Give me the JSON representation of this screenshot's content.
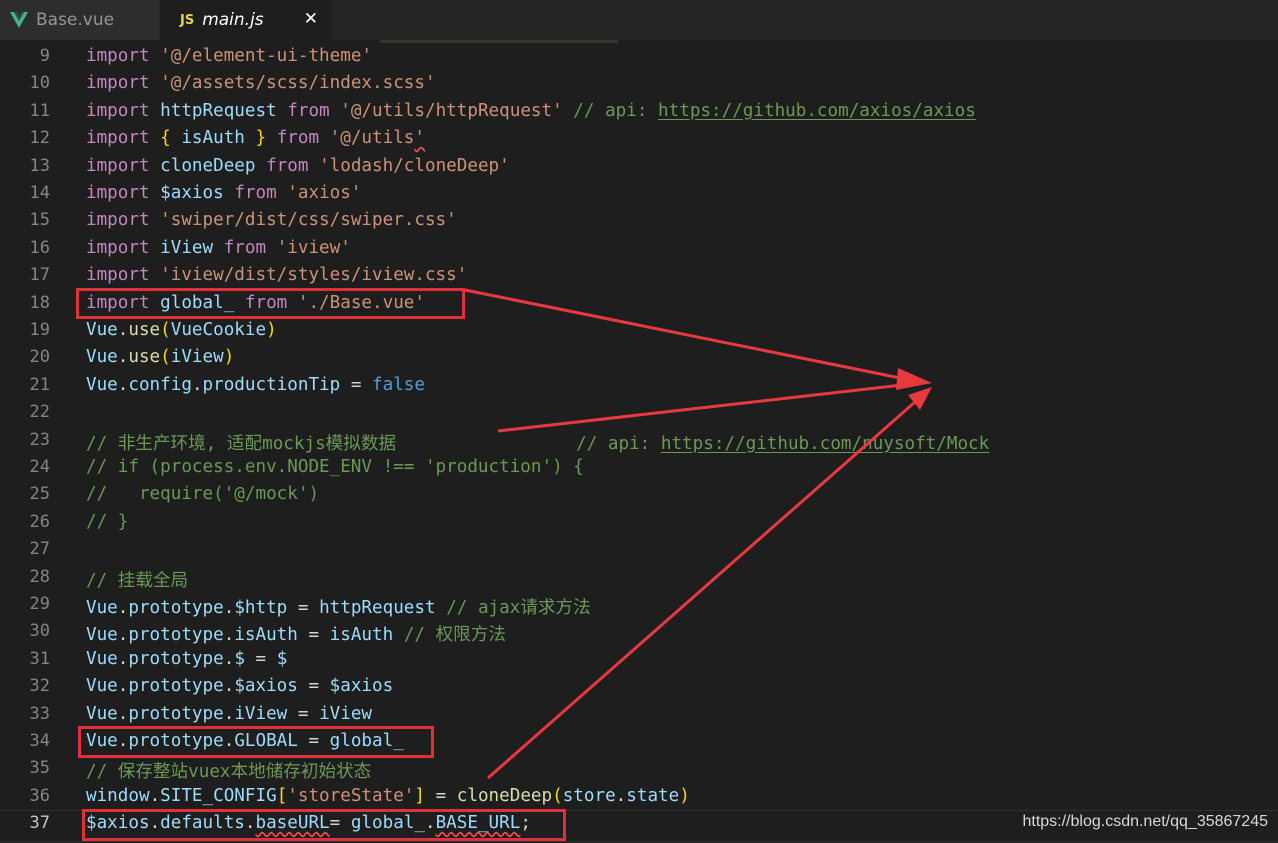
{
  "tabs": [
    {
      "label": "Base.vue",
      "icon": "vue-icon"
    },
    {
      "label": "main.js",
      "icon_label": "JS",
      "icon": "js-icon",
      "close": "✕"
    }
  ],
  "lines": [
    {
      "n": "9",
      "tokens": [
        [
          "k",
          "import"
        ],
        [
          "o",
          " "
        ],
        [
          "s",
          "'@/element-ui-theme'"
        ]
      ]
    },
    {
      "n": "10",
      "tokens": [
        [
          "k",
          "import"
        ],
        [
          "o",
          " "
        ],
        [
          "s",
          "'@/assets/scss/index.scss'"
        ]
      ]
    },
    {
      "n": "11",
      "tokens": [
        [
          "k",
          "import"
        ],
        [
          "o",
          " "
        ],
        [
          "i",
          "httpRequest"
        ],
        [
          "o",
          " "
        ],
        [
          "k",
          "from"
        ],
        [
          "o",
          " "
        ],
        [
          "s",
          "'@/utils/httpRequest'"
        ],
        [
          "o",
          " "
        ],
        [
          "c",
          "// api: "
        ],
        [
          "c u",
          "https://github.com/axios/axios"
        ]
      ]
    },
    {
      "n": "12",
      "tokens": [
        [
          "k",
          "import"
        ],
        [
          "o",
          " "
        ],
        [
          "p",
          "{"
        ],
        [
          "o",
          " "
        ],
        [
          "i",
          "isAuth"
        ],
        [
          "o",
          " "
        ],
        [
          "p",
          "}"
        ],
        [
          "o",
          " "
        ],
        [
          "k",
          "from"
        ],
        [
          "o",
          " "
        ],
        [
          "s",
          "'@/utils"
        ],
        [
          "s sq",
          "'"
        ]
      ]
    },
    {
      "n": "13",
      "tokens": [
        [
          "k",
          "import"
        ],
        [
          "o",
          " "
        ],
        [
          "i",
          "cloneDeep"
        ],
        [
          "o",
          " "
        ],
        [
          "k",
          "from"
        ],
        [
          "o",
          " "
        ],
        [
          "s",
          "'lodash/cloneDeep'"
        ]
      ]
    },
    {
      "n": "14",
      "tokens": [
        [
          "k",
          "import"
        ],
        [
          "o",
          " "
        ],
        [
          "i",
          "$axios"
        ],
        [
          "o",
          " "
        ],
        [
          "k",
          "from"
        ],
        [
          "o",
          " "
        ],
        [
          "s",
          "'axios'"
        ]
      ]
    },
    {
      "n": "15",
      "tokens": [
        [
          "k",
          "import"
        ],
        [
          "o",
          " "
        ],
        [
          "s",
          "'swiper/dist/css/swiper.css'"
        ]
      ]
    },
    {
      "n": "16",
      "tokens": [
        [
          "k",
          "import"
        ],
        [
          "o",
          " "
        ],
        [
          "i",
          "iView"
        ],
        [
          "o",
          " "
        ],
        [
          "k",
          "from"
        ],
        [
          "o",
          " "
        ],
        [
          "s",
          "'iview'"
        ]
      ]
    },
    {
      "n": "17",
      "tokens": [
        [
          "k",
          "import"
        ],
        [
          "o",
          " "
        ],
        [
          "s",
          "'iview/dist/styles/iview.css'"
        ]
      ]
    },
    {
      "n": "18",
      "tokens": [
        [
          "k",
          "import"
        ],
        [
          "o",
          " "
        ],
        [
          "i",
          "global_"
        ],
        [
          "o",
          " "
        ],
        [
          "k",
          "from"
        ],
        [
          "o",
          " "
        ],
        [
          "s",
          "'./Base.vue'"
        ]
      ]
    },
    {
      "n": "19",
      "tokens": [
        [
          "i",
          "Vue"
        ],
        [
          "o",
          "."
        ],
        [
          "f",
          "use"
        ],
        [
          "p",
          "("
        ],
        [
          "i",
          "VueCookie"
        ],
        [
          "p",
          ")"
        ]
      ]
    },
    {
      "n": "20",
      "tokens": [
        [
          "i",
          "Vue"
        ],
        [
          "o",
          "."
        ],
        [
          "f",
          "use"
        ],
        [
          "p",
          "("
        ],
        [
          "i",
          "iView"
        ],
        [
          "p",
          ")"
        ]
      ]
    },
    {
      "n": "21",
      "tokens": [
        [
          "i",
          "Vue"
        ],
        [
          "o",
          "."
        ],
        [
          "i",
          "config"
        ],
        [
          "o",
          "."
        ],
        [
          "i",
          "productionTip"
        ],
        [
          "o",
          " = "
        ],
        [
          "b",
          "false"
        ]
      ]
    },
    {
      "n": "22",
      "tokens": []
    },
    {
      "n": "23",
      "tokens": [
        [
          "c",
          "// 非生产环境, 适配mockjs模拟数据                 // api: "
        ],
        [
          "c u",
          "https://github.com/nuysoft/Mock"
        ]
      ]
    },
    {
      "n": "24",
      "tokens": [
        [
          "c",
          "// if (process.env.NODE_ENV !== 'production') {"
        ]
      ]
    },
    {
      "n": "25",
      "tokens": [
        [
          "c",
          "//   require('@/mock')"
        ]
      ]
    },
    {
      "n": "26",
      "tokens": [
        [
          "c",
          "// }"
        ]
      ]
    },
    {
      "n": "27",
      "tokens": []
    },
    {
      "n": "28",
      "tokens": [
        [
          "c",
          "// 挂载全局"
        ]
      ]
    },
    {
      "n": "29",
      "tokens": [
        [
          "i",
          "Vue"
        ],
        [
          "o",
          "."
        ],
        [
          "i",
          "prototype"
        ],
        [
          "o",
          "."
        ],
        [
          "i",
          "$http"
        ],
        [
          "o",
          " = "
        ],
        [
          "i",
          "httpRequest"
        ],
        [
          "o",
          " "
        ],
        [
          "c",
          "// ajax请求方法"
        ]
      ]
    },
    {
      "n": "30",
      "tokens": [
        [
          "i",
          "Vue"
        ],
        [
          "o",
          "."
        ],
        [
          "i",
          "prototype"
        ],
        [
          "o",
          "."
        ],
        [
          "i",
          "isAuth"
        ],
        [
          "o",
          " = "
        ],
        [
          "i",
          "isAuth"
        ],
        [
          "o",
          " "
        ],
        [
          "c",
          "// 权限方法"
        ]
      ]
    },
    {
      "n": "31",
      "tokens": [
        [
          "i",
          "Vue"
        ],
        [
          "o",
          "."
        ],
        [
          "i",
          "prototype"
        ],
        [
          "o",
          "."
        ],
        [
          "i",
          "$"
        ],
        [
          "o",
          " = "
        ],
        [
          "i",
          "$"
        ]
      ]
    },
    {
      "n": "32",
      "tokens": [
        [
          "i",
          "Vue"
        ],
        [
          "o",
          "."
        ],
        [
          "i",
          "prototype"
        ],
        [
          "o",
          "."
        ],
        [
          "i",
          "$axios"
        ],
        [
          "o",
          " = "
        ],
        [
          "i",
          "$axios"
        ]
      ]
    },
    {
      "n": "33",
      "tokens": [
        [
          "i",
          "Vue"
        ],
        [
          "o",
          "."
        ],
        [
          "i",
          "prototype"
        ],
        [
          "o",
          "."
        ],
        [
          "i",
          "iView"
        ],
        [
          "o",
          " = "
        ],
        [
          "i",
          "iView"
        ]
      ]
    },
    {
      "n": "34",
      "tokens": [
        [
          "i",
          "Vue"
        ],
        [
          "o",
          "."
        ],
        [
          "i",
          "prototype"
        ],
        [
          "o",
          "."
        ],
        [
          "i",
          "GLOBAL"
        ],
        [
          "o",
          " = "
        ],
        [
          "i",
          "global_"
        ]
      ]
    },
    {
      "n": "35",
      "tokens": [
        [
          "c",
          "// 保存整站vuex本地储存初始状态"
        ]
      ]
    },
    {
      "n": "36",
      "tokens": [
        [
          "i",
          "window"
        ],
        [
          "o",
          "."
        ],
        [
          "i",
          "SITE_CONFIG"
        ],
        [
          "p",
          "["
        ],
        [
          "s",
          "'storeState'"
        ],
        [
          "p",
          "]"
        ],
        [
          "o",
          " = "
        ],
        [
          "f",
          "cloneDeep"
        ],
        [
          "p",
          "("
        ],
        [
          "i",
          "store"
        ],
        [
          "o",
          "."
        ],
        [
          "i",
          "state"
        ],
        [
          "p",
          ")"
        ]
      ]
    },
    {
      "n": "37",
      "tokens": [
        [
          "i",
          "$axios"
        ],
        [
          "o",
          "."
        ],
        [
          "i",
          "defaults"
        ],
        [
          "o",
          "."
        ],
        [
          "i sq",
          "baseURL"
        ],
        [
          "o",
          "= "
        ],
        [
          "i",
          "global_"
        ],
        [
          "o",
          "."
        ],
        [
          "i sq",
          "BASE_URL"
        ],
        [
          "o",
          ";"
        ]
      ]
    }
  ],
  "active_line": "37",
  "annotation_color": "#e0303a",
  "watermark": "https://blog.csdn.net/qq_35867245"
}
